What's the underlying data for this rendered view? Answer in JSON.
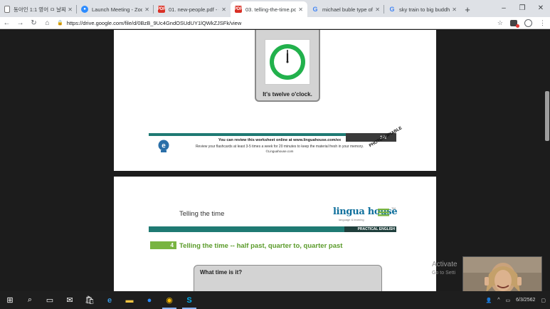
{
  "tabs": [
    {
      "title": "동아인 1:1 영어 ㅁ 날짜…",
      "icon": "document-icon",
      "active": false
    },
    {
      "title": "Launch Meeting - Zoom",
      "icon": "zoom-icon",
      "active": false
    },
    {
      "title": "01. new-people.pdf - G",
      "icon": "pdf-icon",
      "active": false
    },
    {
      "title": "03. telling-the-time.pdf",
      "icon": "pdf-icon",
      "active": true
    },
    {
      "title": "michael buble type of",
      "icon": "google-icon",
      "active": false
    },
    {
      "title": "sky train to big buddha",
      "icon": "google-icon",
      "active": false
    }
  ],
  "toolbar": {
    "url": "https://drive.google.com/file/d/0BzB_9Uc4GndOSUdUY1lQWkZJSFk/view"
  },
  "page1": {
    "clock_caption": "It's twelve o'clock.",
    "page_number": "1/3",
    "footer_line1": "You can review this worksheet online at www.linguahouse.com/ex",
    "footer_line2": "Review your flashcards at least 3-5 times a week for 20 minutes to keep the material fresh in your memory.",
    "footer_line3": "©Linguahouse.com",
    "photocopiable": "PHOTOCOPIABLE"
  },
  "page2": {
    "title": "Telling the time",
    "brand": "lingua house",
    "brand_tagline": "language & learning",
    "brand_tm": "TM",
    "band_label": "PRACTICAL ENGLISH",
    "section_number": "4",
    "section_title": "Telling the time -- half past, quarter to, quarter past",
    "question": "What time is it?"
  },
  "watermark": {
    "line1": "Activate",
    "line2": "Go to Setti"
  },
  "taskbar": {
    "clock": "6/3/2562"
  },
  "colors": {
    "teal_band": "#1f7a73",
    "green_accent": "#78b441",
    "brand_blue": "#0e6f9c",
    "clock_ring": "#22b14c"
  }
}
